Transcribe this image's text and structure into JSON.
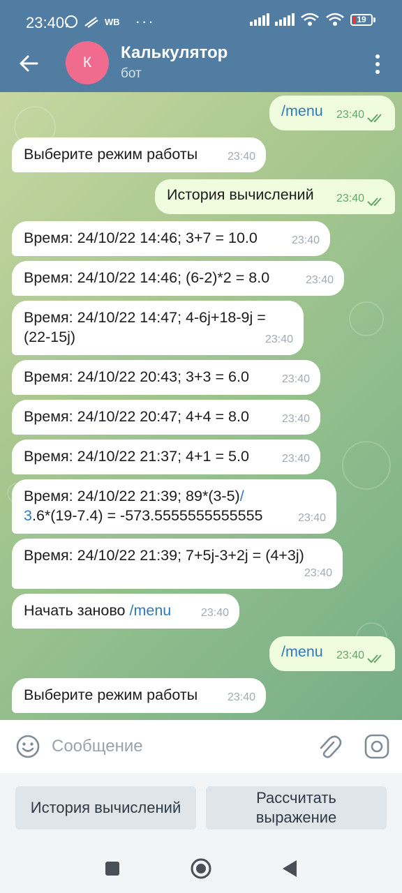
{
  "status_bar": {
    "time": "23:40",
    "carrier_text": "WB",
    "battery_level": "19"
  },
  "app_bar": {
    "avatar_letter": "К",
    "title": "Калькулятор",
    "subtitle": "бот"
  },
  "messages": [
    {
      "dir": "out",
      "text": "/menu",
      "time": "23:40"
    },
    {
      "dir": "in",
      "text": "Выберите режим работы",
      "time": "23:40"
    },
    {
      "dir": "out",
      "text": "История вычислений",
      "time": "23:40"
    },
    {
      "dir": "in",
      "text": "Время: 24/10/22 14:46; 3+7 = 10.0",
      "time": "23:40"
    },
    {
      "dir": "in",
      "text": "Время: 24/10/22 14:46; (6-2)*2 = 8.0",
      "time": "23:40"
    },
    {
      "dir": "in",
      "line1": "Время: 24/10/22 14:47; 4-6j+18-9j =",
      "line2": "(22-15j)",
      "time": "23:40"
    },
    {
      "dir": "in",
      "text": "Время: 24/10/22 20:43; 3+3 = 6.0",
      "time": "23:40"
    },
    {
      "dir": "in",
      "text": "Время: 24/10/22 20:47; 4+4 = 8.0",
      "time": "23:40"
    },
    {
      "dir": "in",
      "text": "Время: 24/10/22 21:37; 4+1 = 5.0",
      "time": "23:40"
    },
    {
      "dir": "in",
      "line1": "Время: 24/10/22 21:39; 89*(3-5)",
      "link1": "/",
      "link2": "3",
      "line2": ".6*(19-7.4) = -573.5555555555555",
      "time": "23:40"
    },
    {
      "dir": "in",
      "text": "Время: 24/10/22 21:39; 7+5j-3+2j = (4+3j)",
      "time": "23:40"
    },
    {
      "dir": "in",
      "text": "Начать заново",
      "link": "/menu",
      "time": "23:40"
    },
    {
      "dir": "out",
      "text": "/menu",
      "time": "23:40"
    },
    {
      "dir": "in",
      "text": "Выберите режим работы",
      "time": "23:40"
    }
  ],
  "composer": {
    "placeholder": "Сообщение"
  },
  "keyboard": {
    "button_history": "История вычислений",
    "button_calc_line1": "Рассчитать",
    "button_calc_line2": "выражение"
  },
  "colors": {
    "header": "#527da3",
    "outgoing_bubble": "#effdde",
    "incoming_bubble": "#ffffff",
    "link": "#2f79b6",
    "avatar": "#f06b8e"
  },
  "icons": [
    "whatsapp-icon",
    "notification-icon",
    "signal-icon",
    "wifi-icon",
    "battery-icon",
    "back-arrow-icon",
    "more-vert-icon",
    "double-check-icon",
    "emoji-icon",
    "attach-icon",
    "camera-icon",
    "nav-square-icon",
    "nav-home-icon",
    "nav-back-icon"
  ]
}
